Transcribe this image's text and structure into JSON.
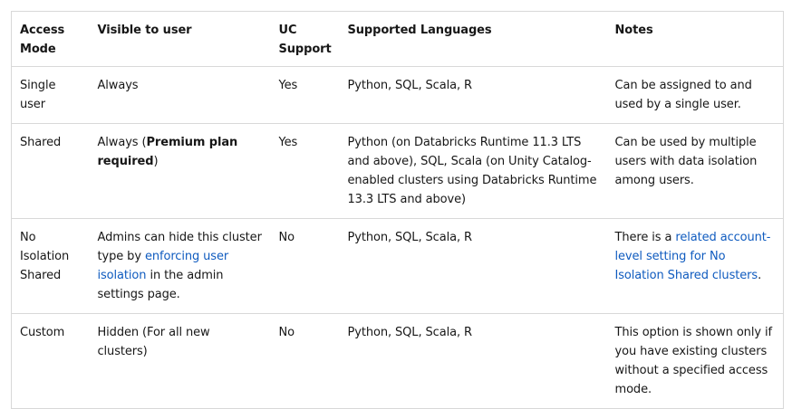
{
  "headers": {
    "access_mode": "Access Mode",
    "visible": "Visible to user",
    "uc": "UC Support",
    "languages": "Supported Languages",
    "notes": "Notes"
  },
  "rows": [
    {
      "mode": "Single user",
      "visible": "Always",
      "uc": "Yes",
      "languages": "Python, SQL, Scala, R",
      "notes": "Can be assigned to and used by a single user."
    },
    {
      "mode": "Shared",
      "visible_pre": "Always (",
      "visible_bold": "Premium plan required",
      "visible_post": ")",
      "uc": "Yes",
      "languages": "Python (on Databricks Runtime 11.3 LTS and above), SQL, Scala (on Unity Catalog-enabled clusters using Databricks Runtime 13.3 LTS and above)",
      "notes": "Can be used by multiple users with data isolation among users."
    },
    {
      "mode": "No Isolation Shared",
      "visible_pre": "Admins can hide this cluster type by ",
      "visible_link": "enforcing user isolation",
      "visible_post": " in the admin settings page.",
      "uc": "No",
      "languages": "Python, SQL, Scala, R",
      "notes_pre": "There is a ",
      "notes_link": "related account-level setting for No Isolation Shared clusters",
      "notes_post": "."
    },
    {
      "mode": "Custom",
      "visible": "Hidden (For all new clusters)",
      "uc": "No",
      "languages": "Python, SQL, Scala, R",
      "notes": "This option is shown only if you have existing clusters without a specified access mode."
    }
  ],
  "colors": {
    "link": "#0f5bbf",
    "border": "#d8d8d8",
    "text": "#171717"
  }
}
